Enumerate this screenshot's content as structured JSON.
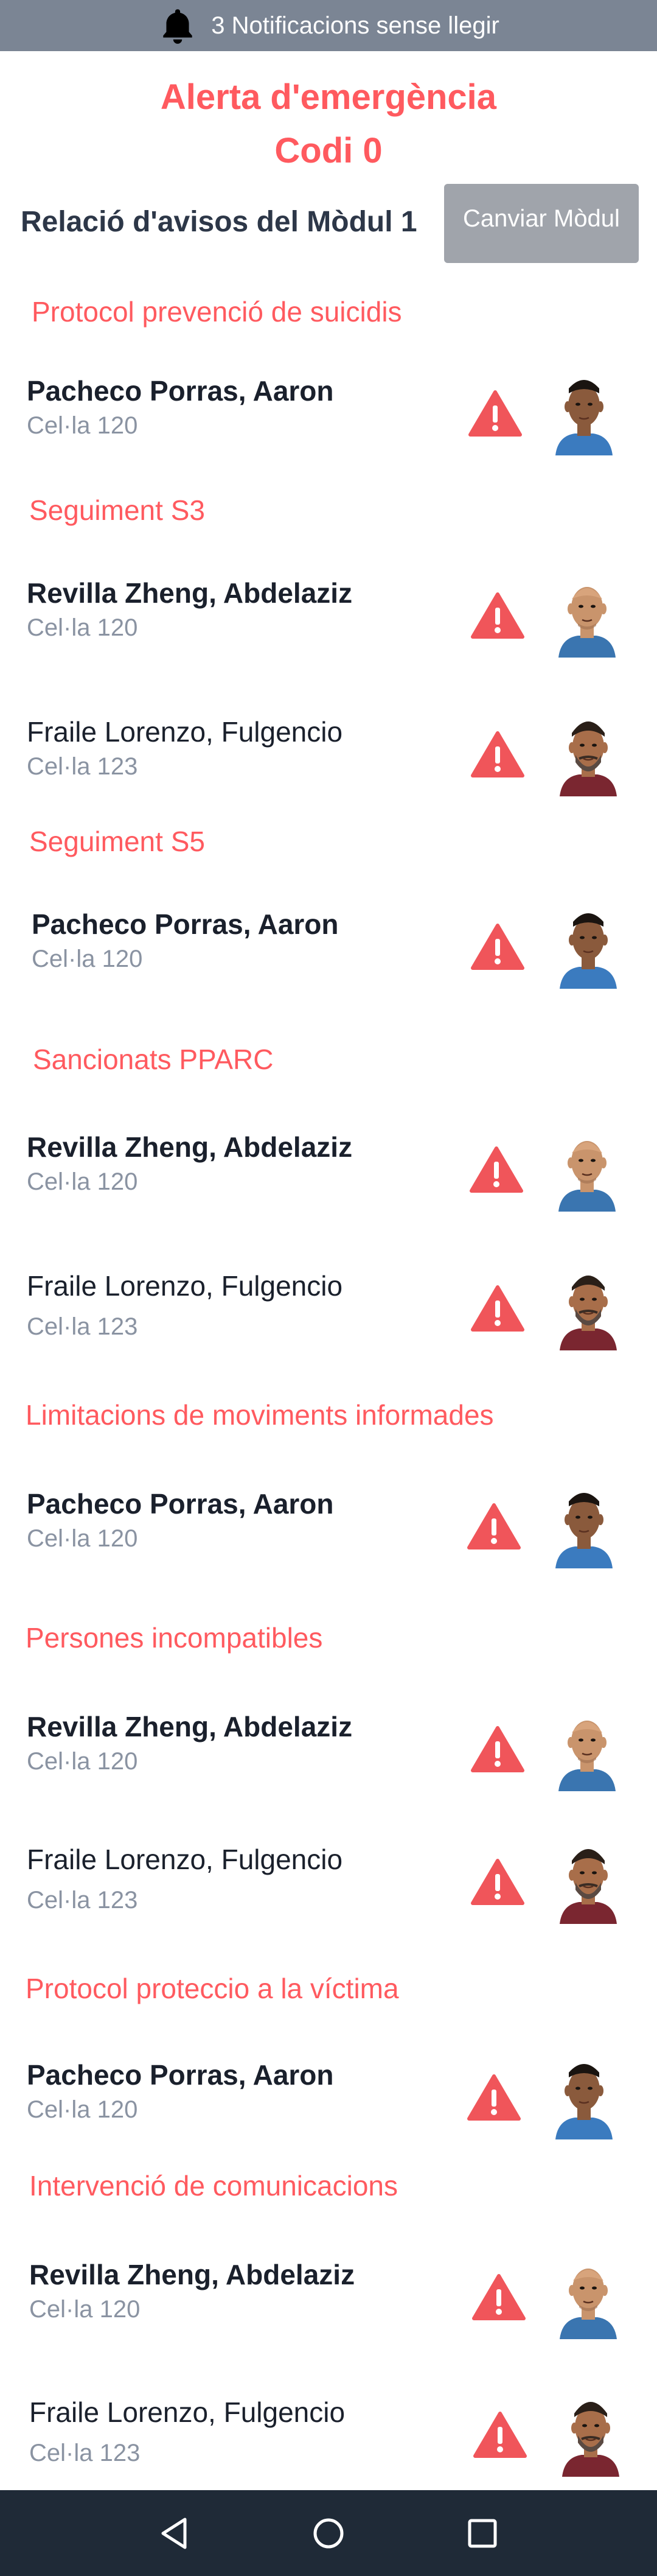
{
  "notifications": {
    "text": "3 Notificacions sense llegir",
    "icon": "bell-icon"
  },
  "header": {
    "title": "Alerta d'emergència",
    "code": "Codi 0"
  },
  "module": {
    "label": "Relació d'avisos del Mòdul 1",
    "change_button": "Canviar Mòdul"
  },
  "colors": {
    "accent": "#ff5a5f",
    "notification_bar": "#7b8594",
    "button_gray": "#a0a4ab",
    "nav_bar": "#1f2a37",
    "cell_text": "#8a93a2"
  },
  "sections": [
    {
      "title": "Protocol prevenció de suicidis",
      "inmates": [
        {
          "name": "Pacheco Porras, Aaron",
          "cell": "Cel·la 120",
          "photo": "young-man-photo"
        }
      ]
    },
    {
      "title": "Seguiment S3",
      "inmates": [
        {
          "name": "Revilla Zheng, Abdelaziz",
          "cell": "Cel·la 120",
          "photo": "bald-man-photo"
        },
        {
          "name": "Fraile Lorenzo, Fulgencio",
          "cell": "Cel·la 123",
          "photo": "bearded-man-photo"
        }
      ]
    },
    {
      "title": "Seguiment S5",
      "inmates": [
        {
          "name": "Pacheco Porras, Aaron",
          "cell": "Cel·la 120",
          "photo": "young-man-photo"
        }
      ]
    },
    {
      "title": "Sancionats PPARC",
      "inmates": [
        {
          "name": "Revilla Zheng, Abdelaziz",
          "cell": "Cel·la 120",
          "photo": "bald-man-photo"
        },
        {
          "name": "Fraile Lorenzo, Fulgencio",
          "cell": "Cel·la 123",
          "photo": "bearded-man-photo"
        }
      ]
    },
    {
      "title": "Limitacions de moviments informades",
      "inmates": [
        {
          "name": "Pacheco Porras, Aaron",
          "cell": "Cel·la 120",
          "photo": "young-man-photo"
        }
      ]
    },
    {
      "title": "Persones incompatibles",
      "inmates": [
        {
          "name": "Revilla Zheng, Abdelaziz",
          "cell": "Cel·la 120",
          "photo": "bald-man-photo"
        },
        {
          "name": "Fraile Lorenzo, Fulgencio",
          "cell": "Cel·la 123",
          "photo": "bearded-man-photo"
        }
      ]
    },
    {
      "title": "Protocol proteccio a la víctima",
      "inmates": [
        {
          "name": "Pacheco Porras, Aaron",
          "cell": "Cel·la 120",
          "photo": "young-man-photo"
        }
      ]
    },
    {
      "title": "Intervenció de comunicacions",
      "inmates": [
        {
          "name": "Revilla Zheng, Abdelaziz",
          "cell": "Cel·la 120",
          "photo": "bald-man-photo"
        },
        {
          "name": "Fraile Lorenzo, Fulgencio",
          "cell": "Cel·la 123",
          "photo": "bearded-man-photo"
        }
      ]
    }
  ],
  "nav": {
    "back_icon": "back-triangle-icon",
    "home_icon": "home-circle-icon",
    "recents_icon": "recents-square-icon"
  }
}
